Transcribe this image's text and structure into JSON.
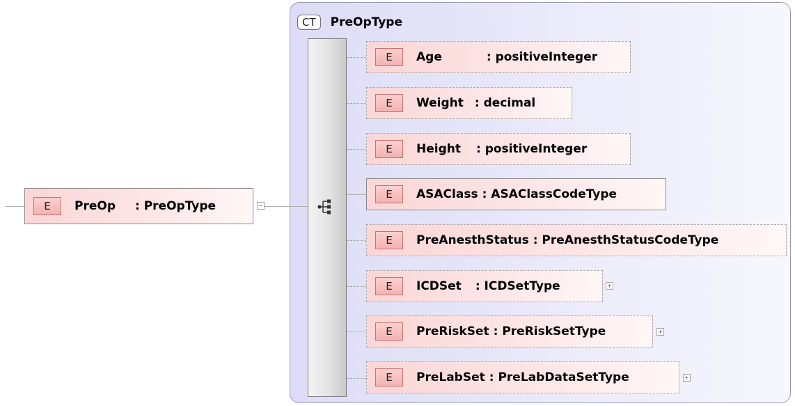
{
  "root": {
    "badge": "E",
    "name": "PreOp",
    "type": ": PreOpType"
  },
  "complex_type": {
    "badge": "CT",
    "name": "PreOpType"
  },
  "elements": [
    {
      "badge": "E",
      "name": "Age",
      "type": ": positiveInteger"
    },
    {
      "badge": "E",
      "name": "Weight",
      "type": ": decimal"
    },
    {
      "badge": "E",
      "name": "Height",
      "type": ": positiveInteger"
    },
    {
      "badge": "E",
      "name": "ASAClass",
      "type": ": ASAClassCodeType"
    },
    {
      "badge": "E",
      "name": "PreAnesthStatus",
      "type": ": PreAnesthStatusCodeType"
    },
    {
      "badge": "E",
      "name": "ICDSet",
      "type": ": ICDSetType"
    },
    {
      "badge": "E",
      "name": "PreRiskSet",
      "type": ": PreRiskSetType"
    },
    {
      "badge": "E",
      "name": "PreLabSet",
      "type": ": PreLabDataSetType"
    }
  ]
}
